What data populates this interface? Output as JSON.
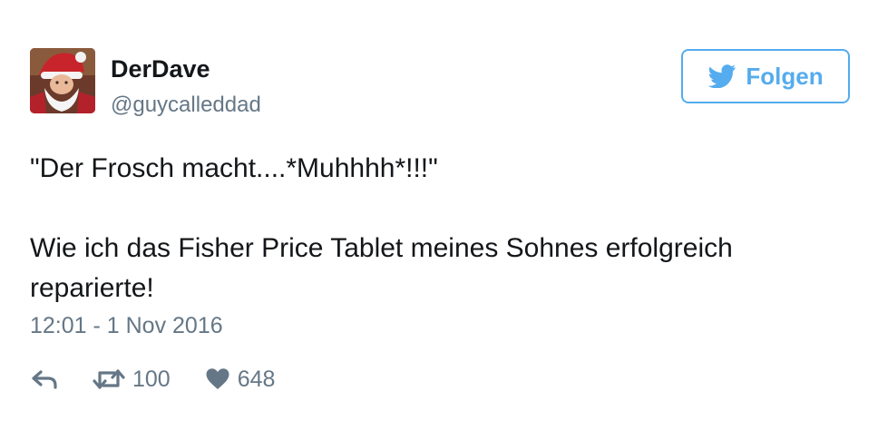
{
  "user": {
    "display_name": "DerDave",
    "handle": "@guycalleddad",
    "avatar_icon": "santa-avatar"
  },
  "follow_button": {
    "label": "Folgen",
    "icon": "twitter-bird-icon",
    "color": "#55acee"
  },
  "tweet": {
    "lines": [
      "\"Der Frosch macht....*Muhhhh*!!!\"",
      "Wie ich das Fisher Price Tablet meines Sohnes erfolgreich",
      "reparierte!"
    ],
    "timestamp": "12:01 - 1 Nov 2016"
  },
  "actions": {
    "reply_icon": "reply-icon",
    "retweet_icon": "retweet-icon",
    "retweet_count": "100",
    "like_icon": "heart-icon",
    "like_count": "648"
  }
}
